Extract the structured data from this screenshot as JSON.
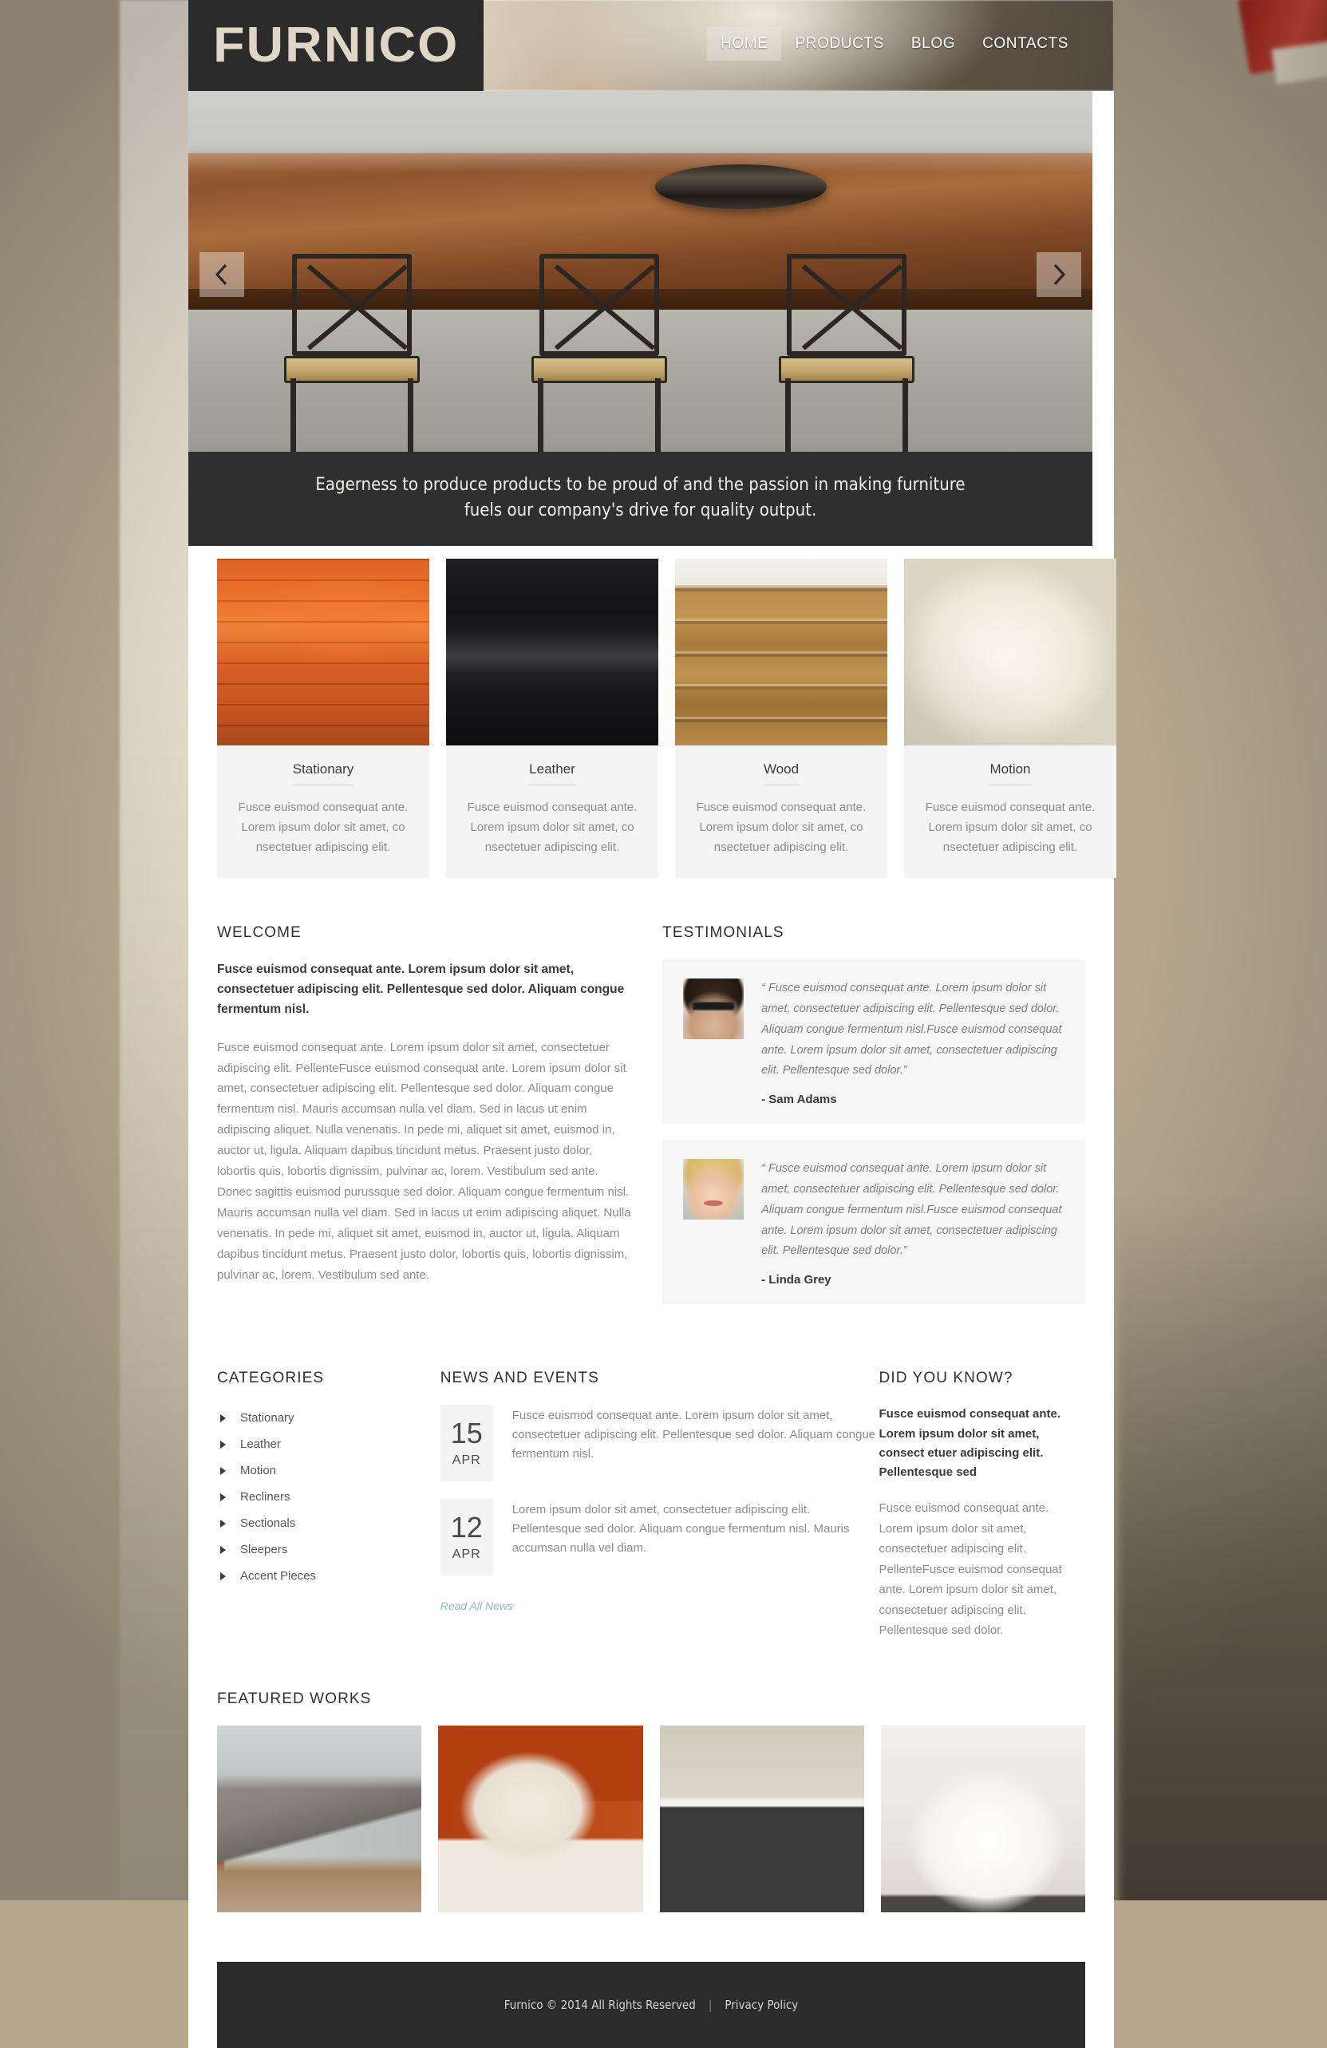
{
  "site": {
    "logo": "FURNICO"
  },
  "nav": {
    "items": [
      {
        "label": "HOME",
        "active": true
      },
      {
        "label": "PRODUCTS",
        "active": false
      },
      {
        "label": "BLOG",
        "active": false
      },
      {
        "label": "CONTACTS",
        "active": false
      }
    ]
  },
  "slider": {
    "caption_line1": "Eagerness to produce products to be proud of and the passion in making furniture",
    "caption_line2": "fuels our company's drive for quality output.",
    "prev_label": "‹",
    "next_label": "›"
  },
  "categories_cards": [
    {
      "title": "Stationary",
      "text": "Fusce euismod consequat ante. Lorem ipsum dolor sit amet, co nsectetuer adipiscing elit.",
      "image": "orange-sofa-photo"
    },
    {
      "title": "Leather",
      "text": "Fusce euismod consequat ante. Lorem ipsum dolor sit amet, co nsectetuer adipiscing elit.",
      "image": "black-leather-sofa-photo"
    },
    {
      "title": "Wood",
      "text": "Fusce euismod consequat ante. Lorem ipsum dolor sit amet, co nsectetuer adipiscing elit.",
      "image": "wood-cabinet-photo"
    },
    {
      "title": "Motion",
      "text": "Fusce euismod consequat ante. Lorem ipsum dolor sit amet, co nsectetuer adipiscing elit.",
      "image": "white-cushion-photo"
    }
  ],
  "welcome": {
    "heading": "WELCOME",
    "lead": "Fusce euismod consequat ante. Lorem ipsum dolor sit amet, consectetuer adipiscing elit. Pellentesque sed dolor. Aliquam congue fermentum nisl.",
    "body": "Fusce euismod consequat ante. Lorem ipsum dolor sit amet, consectetuer adipiscing elit. PellenteFusce euismod consequat ante. Lorem ipsum dolor sit amet, consectetuer adipiscing elit. Pellentesque sed dolor. Aliquam congue fermentum nisl. Mauris accumsan nulla vel diam. Sed in lacus ut enim adipiscing aliquet. Nulla venenatis. In pede mi, aliquet sit amet, euismod in, auctor ut, ligula. Aliquam dapibus tincidunt metus. Praesent justo dolor, lobortis quis, lobortis dignissim, pulvinar ac, lorem. Vestibulum sed ante. Donec sagittis euismod purussque sed dolor. Aliquam congue fermentum nisl. Mauris accumsan nulla vel diam. Sed in lacus ut enim adipiscing aliquet. Nulla venenatis. In pede mi, aliquet sit amet, euismod in, auctor ut, ligula. Aliquam dapibus tincidunt metus. Praesent justo dolor, lobortis quis, lobortis dignissim, pulvinar ac, lorem. Vestibulum sed ante."
  },
  "testimonials": {
    "heading": "TESTIMONIALS",
    "items": [
      {
        "quote": "“ Fusce euismod consequat ante. Lorem ipsum dolor sit amet, consectetuer adipiscing elit. Pellentesque sed dolor. Aliquam congue fermentum nisl.Fusce euismod consequat ante. Lorem ipsum dolor sit amet, consectetuer adipiscing elit. Pellentesque sed dolor.”",
        "author": "- Sam Adams",
        "avatar": "man-with-glasses-photo"
      },
      {
        "quote": "“ Fusce euismod consequat ante. Lorem ipsum dolor sit amet, consectetuer adipiscing elit. Pellentesque sed dolor. Aliquam congue fermentum nisl.Fusce euismod consequat ante. Lorem ipsum dolor sit amet, consectetuer adipiscing elit. Pellentesque sed dolor.”",
        "author": "- Linda Grey",
        "avatar": "blonde-woman-photo"
      }
    ]
  },
  "categories_list": {
    "heading": "CATEGORIES",
    "items": [
      "Stationary",
      "Leather",
      "Motion",
      "Recliners",
      "Sectionals",
      "Sleepers",
      "Accent Pieces"
    ]
  },
  "news": {
    "heading": "NEWS AND EVENTS",
    "items": [
      {
        "day": "15",
        "month": "APR",
        "text": "Fusce euismod consequat ante. Lorem ipsum dolor sit amet, consectetuer adipiscing elit. Pellentesque sed dolor. Aliquam congue fermentum nisl."
      },
      {
        "day": "12",
        "month": "APR",
        "text": "Lorem ipsum dolor sit amet, consectetuer adipiscing elit. Pellentesque sed dolor. Aliquam congue fermentum nisl. Mauris accumsan nulla vel diam."
      }
    ],
    "read_all": "Read All News"
  },
  "did_you_know": {
    "heading": "DID YOU KNOW?",
    "lead": "Fusce euismod consequat ante. Lorem ipsum dolor sit amet, consect etuer adipiscing elit. Pellentesque sed",
    "body": "Fusce euismod consequat ante. Lorem ipsum dolor sit amet, consectetuer adipiscing elit. PellenteFusce euismod consequat ante. Lorem ipsum dolor sit amet, consectetuer adipiscing elit. Pellentesque sed dolor."
  },
  "featured_works": {
    "heading": "FEATURED WORKS",
    "items": [
      {
        "image": "kitchen-counter-photo"
      },
      {
        "image": "armchair-with-pillow-photo"
      },
      {
        "image": "bathroom-vanity-photo"
      },
      {
        "image": "white-sofa-photo"
      }
    ]
  },
  "footer": {
    "copyright": "Furnico © 2014 All Rights Reserved",
    "separator": "|",
    "privacy": "Privacy Policy"
  }
}
